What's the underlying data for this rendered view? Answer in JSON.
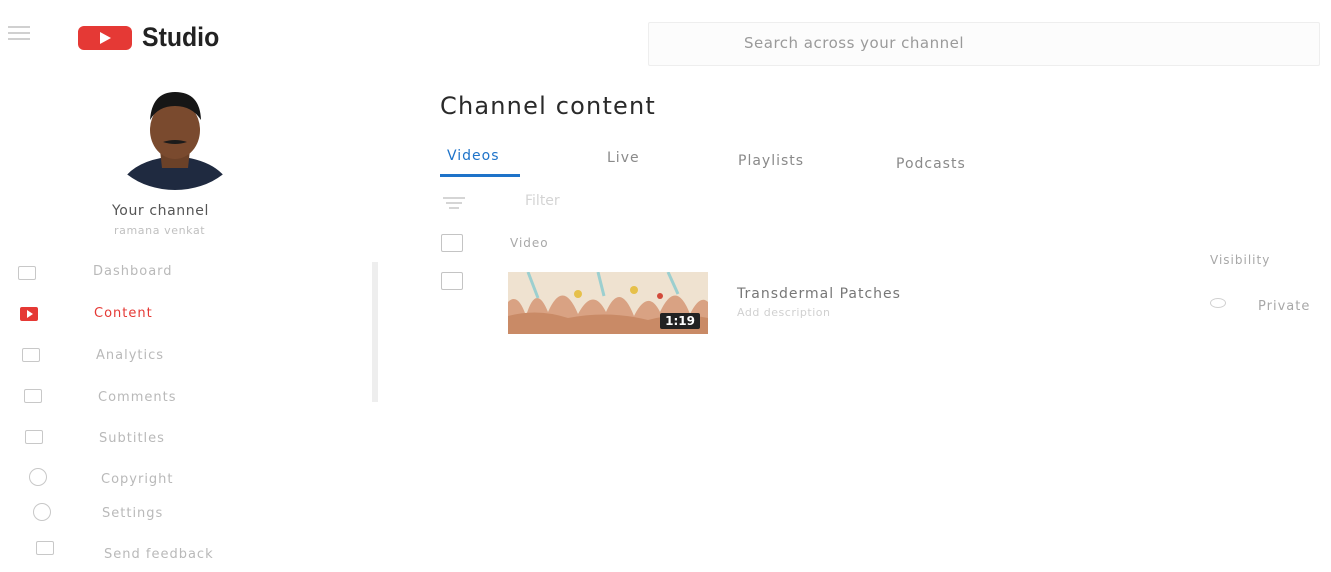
{
  "header": {
    "logo_text": "Studio",
    "search_placeholder": "Search across your channel"
  },
  "channel": {
    "label": "Your channel",
    "handle": "ramana venkat"
  },
  "sidebar": {
    "items": [
      {
        "label": "Dashboard",
        "icon": "dashboard-icon"
      },
      {
        "label": "Content",
        "icon": "content-icon",
        "active": true
      },
      {
        "label": "Analytics",
        "icon": "analytics-icon"
      },
      {
        "label": "Comments",
        "icon": "comments-icon"
      },
      {
        "label": "Subtitles",
        "icon": "subtitles-icon"
      },
      {
        "label": "Copyright",
        "icon": "copyright-icon"
      },
      {
        "label": "Settings",
        "icon": "settings-icon"
      },
      {
        "label": "Send feedback",
        "icon": "feedback-icon"
      }
    ]
  },
  "main": {
    "title": "Channel content",
    "tabs": [
      "Videos",
      "Live",
      "Playlists",
      "Podcasts"
    ],
    "filter_label": "Filter",
    "columns": {
      "video": "Video",
      "visibility": "Visibility"
    },
    "videos": [
      {
        "title": "Transdermal Patches",
        "description": "Add description",
        "duration": "1:19",
        "visibility": "Private"
      }
    ]
  },
  "colors": {
    "accent_red": "#e53935",
    "tab_blue": "#1e73c9"
  }
}
